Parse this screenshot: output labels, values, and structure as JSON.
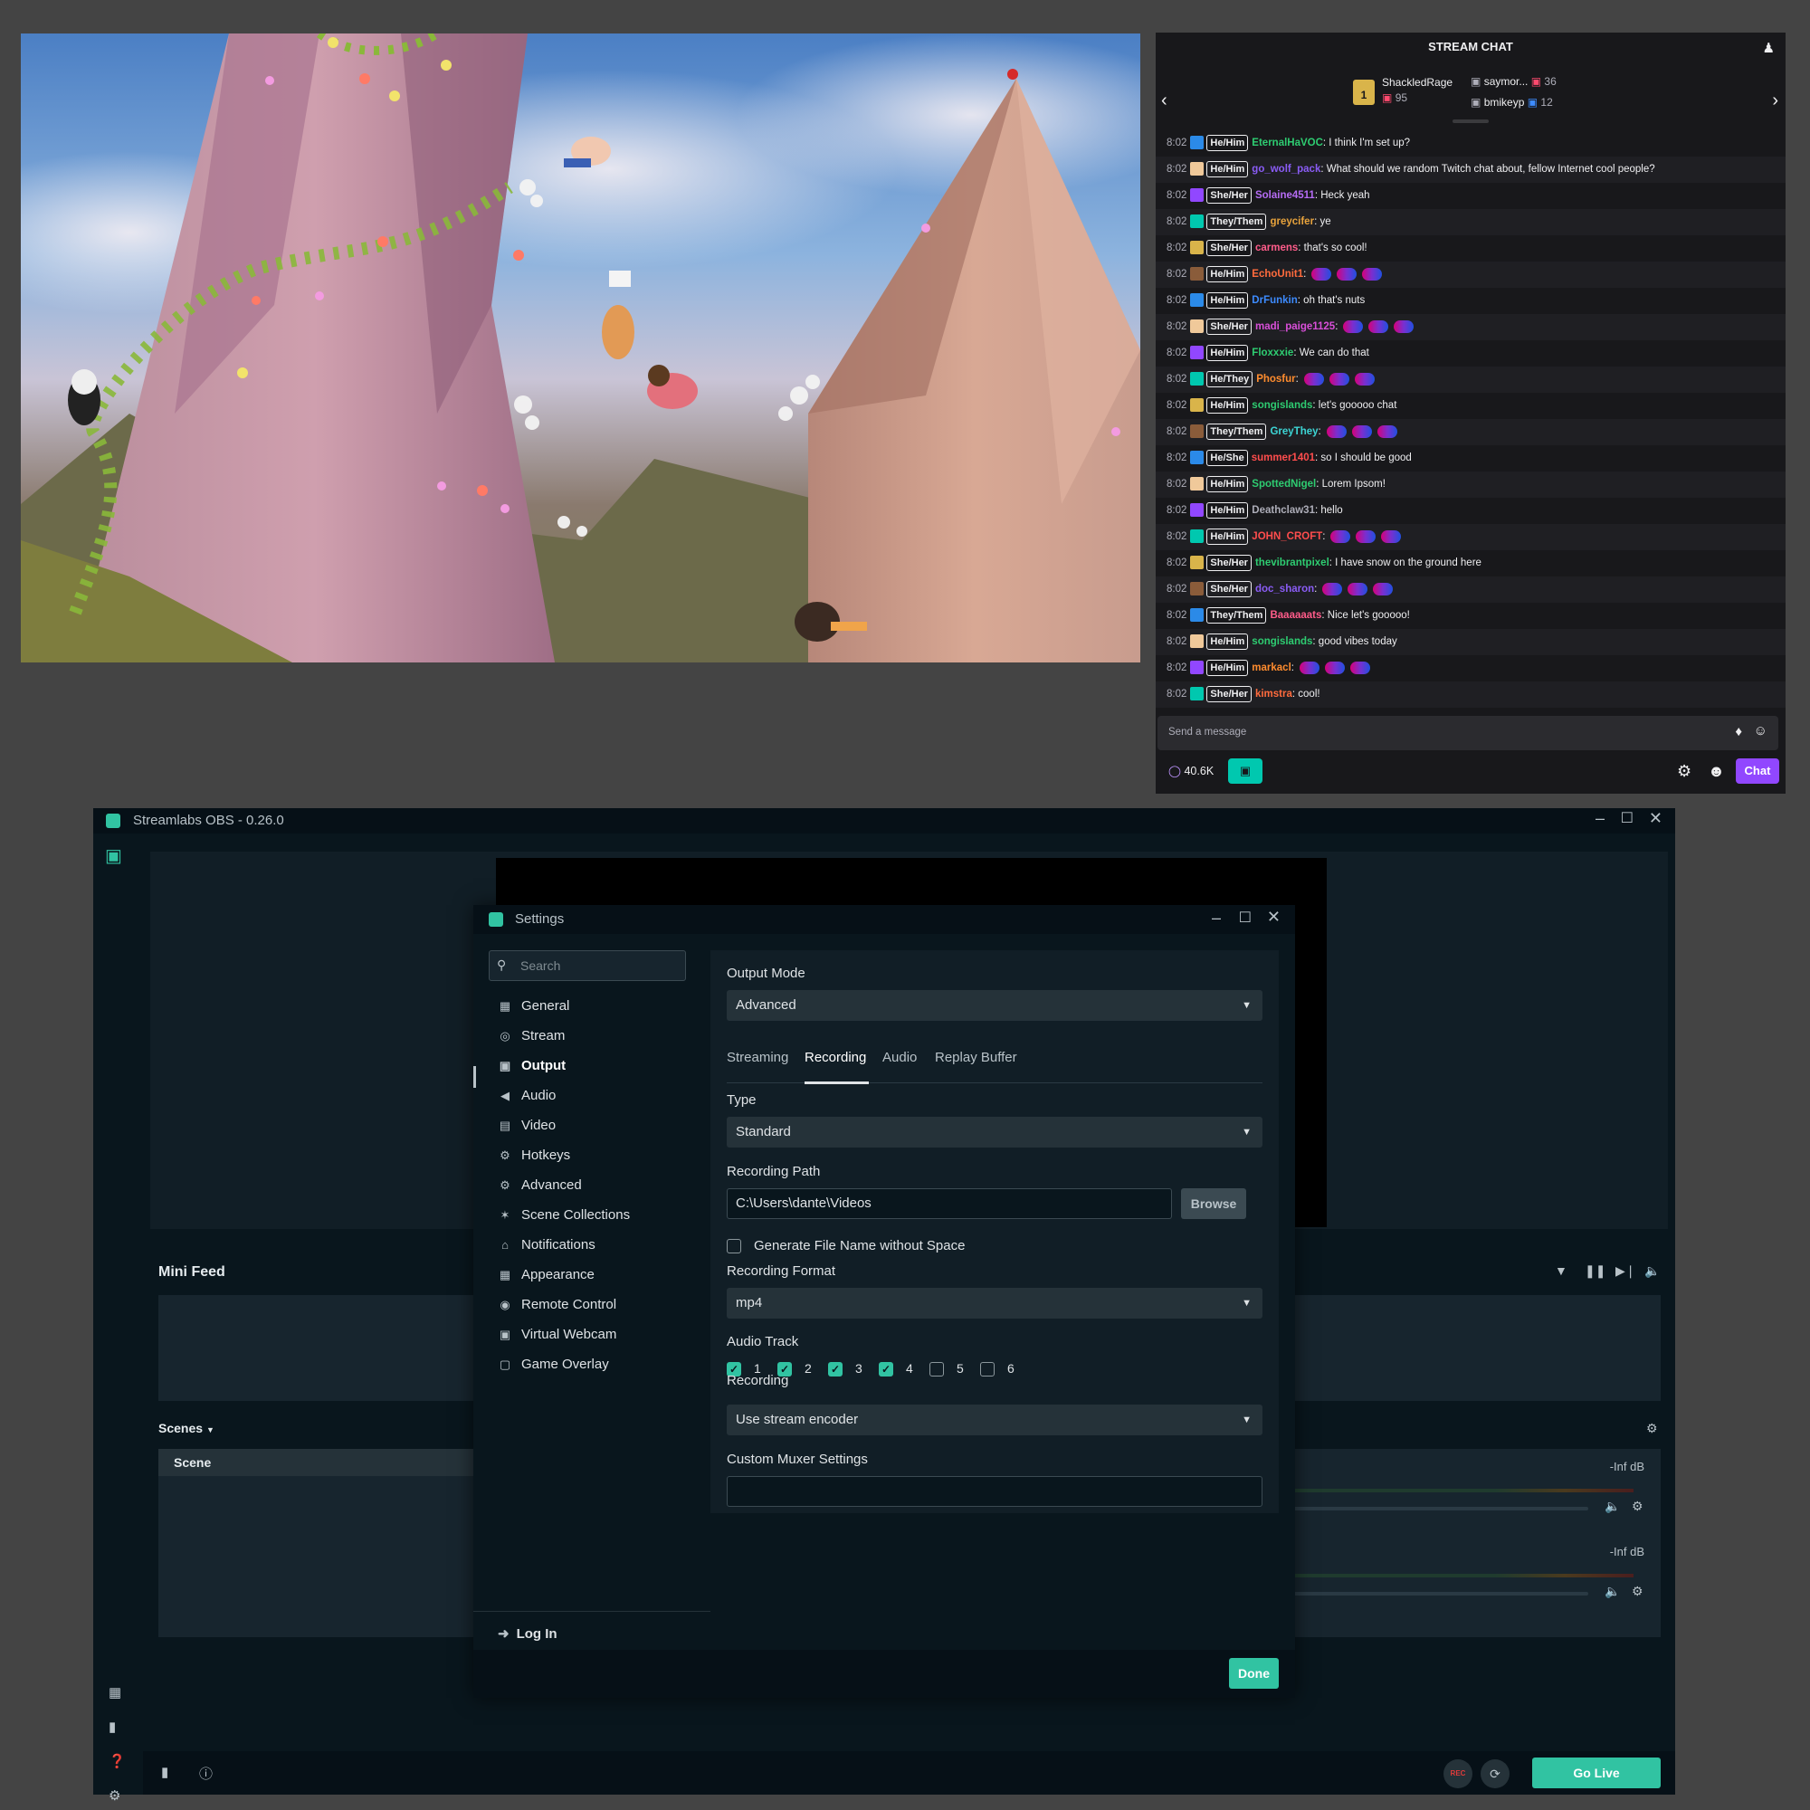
{
  "chat": {
    "title": "STREAM CHAT",
    "gifters": [
      {
        "name": "ShackledRage",
        "count": "95"
      },
      {
        "name": "saymor...",
        "count": "36"
      },
      {
        "name": "bmikeyp",
        "count": "12"
      }
    ],
    "gift_rank_badge": "1",
    "messages": [
      {
        "time": "8:02",
        "pronoun": "He/Him",
        "user": "EternalHaVOC",
        "color": "#2ecc71",
        "text": ": I think I'm set up?",
        "alt": false
      },
      {
        "time": "8:02",
        "pronoun": "He/Him",
        "user": "go_wolf_pack",
        "color": "#8a5cf5",
        "text": ": What should we random Twitch chat about, fellow Internet cool people?",
        "alt": true
      },
      {
        "time": "8:02",
        "pronoun": "She/Her",
        "user": "Solaine4511",
        "color": "#b66cf5",
        "text": ": Heck yeah",
        "alt": false
      },
      {
        "time": "8:02",
        "pronoun": "They/Them",
        "user": "greycifer",
        "color": "#e8a33c",
        "text": ": ye",
        "alt": true
      },
      {
        "time": "8:02",
        "pronoun": "She/Her",
        "user": "carmens",
        "color": "#ff5c8a",
        "text": ": that's so cool!",
        "alt": false
      },
      {
        "time": "8:02",
        "pronoun": "He/Him",
        "user": "EchoUnit1",
        "color": "#ff6b3d",
        "text": ":",
        "alt": true
      },
      {
        "time": "8:02",
        "pronoun": "He/Him",
        "user": "DrFunkin",
        "color": "#3d8bff",
        "text": ": oh that's nuts",
        "alt": false
      },
      {
        "time": "8:02",
        "pronoun": "She/Her",
        "user": "madi_paige1125",
        "color": "#d94fd9",
        "text": ":",
        "alt": true
      },
      {
        "time": "8:02",
        "pronoun": "He/Him",
        "user": "Floxxxie",
        "color": "#2ecc71",
        "text": ": We can do that",
        "alt": false
      },
      {
        "time": "8:02",
        "pronoun": "He/They",
        "user": "Phosfur",
        "color": "#ff8c2e",
        "text": ":",
        "alt": true
      },
      {
        "time": "8:02",
        "pronoun": "He/Him",
        "user": "songislands",
        "color": "#2ecc71",
        "text": ": let's gooooo chat",
        "alt": false
      },
      {
        "time": "8:02",
        "pronoun": "They/Them",
        "user": "GreyThey",
        "color": "#3dd6d6",
        "text": ":",
        "alt": true
      },
      {
        "time": "8:02",
        "pronoun": "He/She",
        "user": "summer1401",
        "color": "#ff4d4d",
        "text": ": so I should be good",
        "alt": false
      },
      {
        "time": "8:02",
        "pronoun": "He/Him",
        "user": "SpottedNigel",
        "color": "#2ecc71",
        "text": ": Lorem Ipsom!",
        "alt": true
      },
      {
        "time": "8:02",
        "pronoun": "He/Him",
        "user": "Deathclaw31",
        "color": "#adadb8",
        "text": ": hello",
        "alt": false
      },
      {
        "time": "8:02",
        "pronoun": "He/Him",
        "user": "JOHN_CROFT",
        "color": "#ff4d4d",
        "text": ":",
        "alt": true
      },
      {
        "time": "8:02",
        "pronoun": "She/Her",
        "user": "thevibrantpixel",
        "color": "#2ecc71",
        "text": ": I have snow on the ground here",
        "alt": false
      },
      {
        "time": "8:02",
        "pronoun": "She/Her",
        "user": "doc_sharon",
        "color": "#8a5cf5",
        "text": ":",
        "alt": true
      },
      {
        "time": "8:02",
        "pronoun": "They/Them",
        "user": "Baaaaaats",
        "color": "#ff5c8a",
        "text": ": Nice let's gooooo!",
        "alt": false
      },
      {
        "time": "8:02",
        "pronoun": "He/Him",
        "user": "songislands",
        "color": "#2ecc71",
        "text": ": good vibes today",
        "alt": true
      },
      {
        "time": "8:02",
        "pronoun": "He/Him",
        "user": "markacl",
        "color": "#ff8c2e",
        "text": ":",
        "alt": false
      },
      {
        "time": "8:02",
        "pronoun": "She/Her",
        "user": "kimstra",
        "color": "#ff6b3d",
        "text": ": cool!",
        "alt": true
      }
    ],
    "input_placeholder": "Send a message",
    "points": "40.6K",
    "chat_button": "Chat",
    "accent": "#9147ff"
  },
  "obs": {
    "title": "Streamlabs OBS - 0.26.0",
    "mini_feed": "Mini Feed",
    "scenes_label": "Scenes",
    "scene_item": "Scene",
    "mixer_db_1": "-Inf dB",
    "mixer_db_2": "-Inf dB",
    "go_live": "Go Live",
    "rec_label": "REC",
    "accent": "#31c3a2"
  },
  "settings": {
    "title": "Settings",
    "search_placeholder": "Search",
    "nav": [
      {
        "label": "General",
        "icon": "grid-icon"
      },
      {
        "label": "Stream",
        "icon": "globe-icon"
      },
      {
        "label": "Output",
        "icon": "output-icon",
        "active": true
      },
      {
        "label": "Audio",
        "icon": "speaker-icon"
      },
      {
        "label": "Video",
        "icon": "film-icon"
      },
      {
        "label": "Hotkeys",
        "icon": "gear-icon"
      },
      {
        "label": "Advanced",
        "icon": "cogs-icon"
      },
      {
        "label": "Scene Collections",
        "icon": "wand-icon"
      },
      {
        "label": "Notifications",
        "icon": "bell-icon"
      },
      {
        "label": "Appearance",
        "icon": "grid-icon"
      },
      {
        "label": "Remote Control",
        "icon": "remote-icon"
      },
      {
        "label": "Virtual Webcam",
        "icon": "camera-icon"
      },
      {
        "label": "Game Overlay",
        "icon": "overlay-icon"
      }
    ],
    "login": "Log In",
    "output_mode_label": "Output Mode",
    "output_mode_value": "Advanced",
    "tabs": [
      "Streaming",
      "Recording",
      "Audio",
      "Replay Buffer"
    ],
    "active_tab": "Recording",
    "type_label": "Type",
    "type_value": "Standard",
    "recording_path_label": "Recording Path",
    "recording_path_value": "C:\\Users\\dante\\Videos",
    "browse": "Browse",
    "gen_filename_label": "Generate File Name without Space",
    "recording_format_label": "Recording Format",
    "recording_format_value": "mp4",
    "audio_track_label": "Audio Track",
    "tracks": [
      {
        "label": "1",
        "checked": true
      },
      {
        "label": "2",
        "checked": true
      },
      {
        "label": "3",
        "checked": true
      },
      {
        "label": "4",
        "checked": true
      },
      {
        "label": "5",
        "checked": false
      },
      {
        "label": "6",
        "checked": false
      }
    ],
    "recording_label": "Recording",
    "recording_encoder_value": "Use stream encoder",
    "muxer_label": "Custom Muxer Settings",
    "muxer_value": "",
    "done": "Done"
  }
}
